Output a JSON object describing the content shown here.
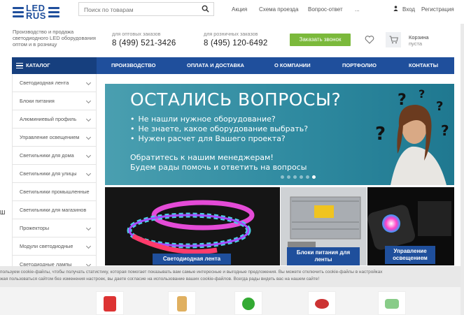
{
  "logo": {
    "line1": "LED",
    "line2": "RUS"
  },
  "search": {
    "placeholder": "Поиск по товарам"
  },
  "top_links": [
    "Акция",
    "Схема проезда",
    "Вопрос-ответ",
    "..."
  ],
  "auth": {
    "login": "Вход",
    "register": "Регистрация"
  },
  "tagline": "Производство и продажа светодиодного LED оборудования оптом и в розницу",
  "phones": [
    {
      "label": "для оптовых заказов",
      "number": "8 (499) 521-3426"
    },
    {
      "label": "для розничных заказов",
      "number": "8 (495) 120-6492"
    }
  ],
  "callback_label": "Заказать звонок",
  "cart": {
    "label": "Корзина",
    "status": "пуста"
  },
  "nav": {
    "catalog": "КАТАЛОГ",
    "items": [
      "ПРОИЗВОДСТВО",
      "ОПЛАТА И ДОСТАВКА",
      "О КОМПАНИИ",
      "ПОРТФОЛИО",
      "КОНТАКТЫ"
    ]
  },
  "sidebar": {
    "items": [
      "Светодиодная лента",
      "Блоки питания",
      "Алюминиевый профиль",
      "Управление освещением",
      "Светильники для дома",
      "Светильники для улицы",
      "Светильники промышленные",
      "Светильники для магазинов",
      "Прожекторы",
      "Модули светодиодные",
      "Светодиодные лампы"
    ]
  },
  "banner": {
    "title": "ОСТАЛИСЬ ВОПРОСЫ?",
    "bullets": [
      "Не нашли нужное оборудование?",
      "Не знаете, какое оборудование выбрать?",
      "Нужен расчет для Вашего проекта?"
    ],
    "cta_line1": "Обратитесь к нашим менеджерам!",
    "cta_line2": "Будем рады помочь и ответить на вопросы",
    "slide_count": 6,
    "active_slide": 6
  },
  "tiles": [
    {
      "caption": "Светодиодная лента"
    },
    {
      "caption": "Блоки питания для ленты"
    },
    {
      "caption": "Управление освещением"
    }
  ],
  "cookie": {
    "line1": "пользуем cookie-файлы, чтобы получать статистику, которая помогает показывать вам самые интересные и выгодные предложения. Вы можете отключить cookie-файлы в настройках",
    "line2": "жая пользоваться сайтом без изменения настроек, вы даете согласие на использование ваших cookie-файлов. Всегда рады видеть вас на нашем сайте!"
  },
  "left_edge_char": "Ш",
  "colors": {
    "brand": "#1f4f9c",
    "accent_green": "#7bb93b"
  }
}
